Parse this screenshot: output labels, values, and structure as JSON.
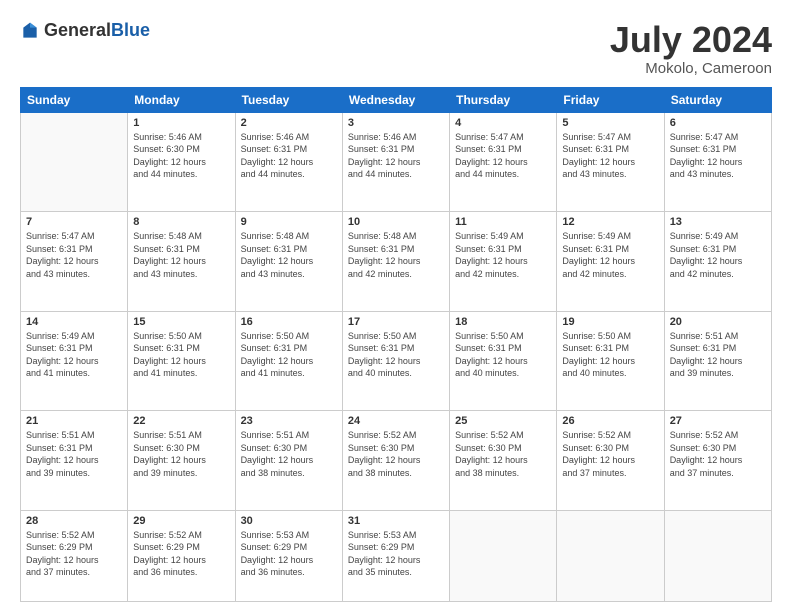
{
  "header": {
    "logo_general": "General",
    "logo_blue": "Blue",
    "title": "July 2024",
    "location": "Mokolo, Cameroon"
  },
  "days_of_week": [
    "Sunday",
    "Monday",
    "Tuesday",
    "Wednesday",
    "Thursday",
    "Friday",
    "Saturday"
  ],
  "weeks": [
    [
      {
        "day": "",
        "content": ""
      },
      {
        "day": "1",
        "content": "Sunrise: 5:46 AM\nSunset: 6:30 PM\nDaylight: 12 hours\nand 44 minutes."
      },
      {
        "day": "2",
        "content": "Sunrise: 5:46 AM\nSunset: 6:31 PM\nDaylight: 12 hours\nand 44 minutes."
      },
      {
        "day": "3",
        "content": "Sunrise: 5:46 AM\nSunset: 6:31 PM\nDaylight: 12 hours\nand 44 minutes."
      },
      {
        "day": "4",
        "content": "Sunrise: 5:47 AM\nSunset: 6:31 PM\nDaylight: 12 hours\nand 44 minutes."
      },
      {
        "day": "5",
        "content": "Sunrise: 5:47 AM\nSunset: 6:31 PM\nDaylight: 12 hours\nand 43 minutes."
      },
      {
        "day": "6",
        "content": "Sunrise: 5:47 AM\nSunset: 6:31 PM\nDaylight: 12 hours\nand 43 minutes."
      }
    ],
    [
      {
        "day": "7",
        "content": "Sunrise: 5:47 AM\nSunset: 6:31 PM\nDaylight: 12 hours\nand 43 minutes."
      },
      {
        "day": "8",
        "content": "Sunrise: 5:48 AM\nSunset: 6:31 PM\nDaylight: 12 hours\nand 43 minutes."
      },
      {
        "day": "9",
        "content": "Sunrise: 5:48 AM\nSunset: 6:31 PM\nDaylight: 12 hours\nand 43 minutes."
      },
      {
        "day": "10",
        "content": "Sunrise: 5:48 AM\nSunset: 6:31 PM\nDaylight: 12 hours\nand 42 minutes."
      },
      {
        "day": "11",
        "content": "Sunrise: 5:49 AM\nSunset: 6:31 PM\nDaylight: 12 hours\nand 42 minutes."
      },
      {
        "day": "12",
        "content": "Sunrise: 5:49 AM\nSunset: 6:31 PM\nDaylight: 12 hours\nand 42 minutes."
      },
      {
        "day": "13",
        "content": "Sunrise: 5:49 AM\nSunset: 6:31 PM\nDaylight: 12 hours\nand 42 minutes."
      }
    ],
    [
      {
        "day": "14",
        "content": "Sunrise: 5:49 AM\nSunset: 6:31 PM\nDaylight: 12 hours\nand 41 minutes."
      },
      {
        "day": "15",
        "content": "Sunrise: 5:50 AM\nSunset: 6:31 PM\nDaylight: 12 hours\nand 41 minutes."
      },
      {
        "day": "16",
        "content": "Sunrise: 5:50 AM\nSunset: 6:31 PM\nDaylight: 12 hours\nand 41 minutes."
      },
      {
        "day": "17",
        "content": "Sunrise: 5:50 AM\nSunset: 6:31 PM\nDaylight: 12 hours\nand 40 minutes."
      },
      {
        "day": "18",
        "content": "Sunrise: 5:50 AM\nSunset: 6:31 PM\nDaylight: 12 hours\nand 40 minutes."
      },
      {
        "day": "19",
        "content": "Sunrise: 5:50 AM\nSunset: 6:31 PM\nDaylight: 12 hours\nand 40 minutes."
      },
      {
        "day": "20",
        "content": "Sunrise: 5:51 AM\nSunset: 6:31 PM\nDaylight: 12 hours\nand 39 minutes."
      }
    ],
    [
      {
        "day": "21",
        "content": "Sunrise: 5:51 AM\nSunset: 6:31 PM\nDaylight: 12 hours\nand 39 minutes."
      },
      {
        "day": "22",
        "content": "Sunrise: 5:51 AM\nSunset: 6:30 PM\nDaylight: 12 hours\nand 39 minutes."
      },
      {
        "day": "23",
        "content": "Sunrise: 5:51 AM\nSunset: 6:30 PM\nDaylight: 12 hours\nand 38 minutes."
      },
      {
        "day": "24",
        "content": "Sunrise: 5:52 AM\nSunset: 6:30 PM\nDaylight: 12 hours\nand 38 minutes."
      },
      {
        "day": "25",
        "content": "Sunrise: 5:52 AM\nSunset: 6:30 PM\nDaylight: 12 hours\nand 38 minutes."
      },
      {
        "day": "26",
        "content": "Sunrise: 5:52 AM\nSunset: 6:30 PM\nDaylight: 12 hours\nand 37 minutes."
      },
      {
        "day": "27",
        "content": "Sunrise: 5:52 AM\nSunset: 6:30 PM\nDaylight: 12 hours\nand 37 minutes."
      }
    ],
    [
      {
        "day": "28",
        "content": "Sunrise: 5:52 AM\nSunset: 6:29 PM\nDaylight: 12 hours\nand 37 minutes."
      },
      {
        "day": "29",
        "content": "Sunrise: 5:52 AM\nSunset: 6:29 PM\nDaylight: 12 hours\nand 36 minutes."
      },
      {
        "day": "30",
        "content": "Sunrise: 5:53 AM\nSunset: 6:29 PM\nDaylight: 12 hours\nand 36 minutes."
      },
      {
        "day": "31",
        "content": "Sunrise: 5:53 AM\nSunset: 6:29 PM\nDaylight: 12 hours\nand 35 minutes."
      },
      {
        "day": "",
        "content": ""
      },
      {
        "day": "",
        "content": ""
      },
      {
        "day": "",
        "content": ""
      }
    ]
  ]
}
